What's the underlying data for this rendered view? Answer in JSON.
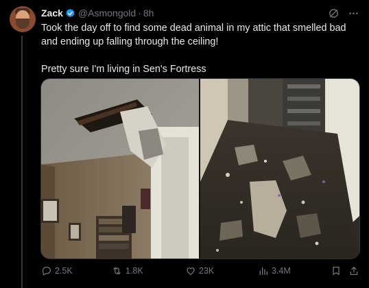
{
  "author": {
    "display_name": "Zack",
    "handle": "@Asmongold",
    "separator": "·",
    "timestamp": "8h"
  },
  "tweet": {
    "line1": "Took the day off to find some dead animal in my attic that smelled bad and ending up falling through the ceiling!",
    "line2": "Pretty sure I'm living in Sen's Fortress"
  },
  "media": {
    "left_photo_subject": "collapsed-ceiling-hole",
    "right_photo_subject": "debris-covered-floor"
  },
  "actions": {
    "replies": "2.5K",
    "reposts": "1.8K",
    "likes": "23K",
    "views": "3.4M"
  },
  "colors": {
    "background": "#000000",
    "primary_text": "#e7e9ea",
    "secondary_text": "#71767b",
    "verified_badge": "#1d9bf0",
    "border": "#2f3336"
  },
  "icons": [
    "verified-badge-icon",
    "grok-icon",
    "more-icon",
    "reply-icon",
    "repost-icon",
    "like-icon",
    "views-icon",
    "bookmark-icon",
    "share-icon"
  ]
}
